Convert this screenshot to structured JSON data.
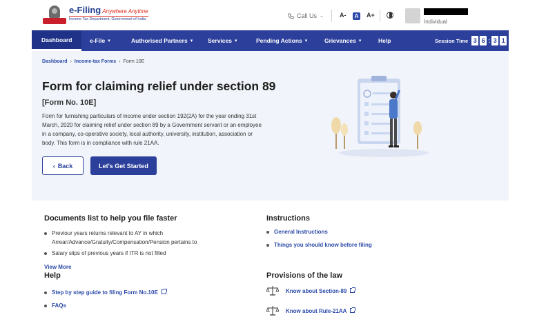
{
  "header": {
    "logo_title": "e-Filing",
    "logo_tagline": "Anywhere Anytime",
    "logo_subtitle": "Income Tax Department, Government of India",
    "call_us": "Call Us",
    "font_decrease": "A-",
    "font_normal": "A",
    "font_increase": "A+",
    "user_role": "Individual"
  },
  "nav": {
    "items": [
      {
        "label": "Dashboard"
      },
      {
        "label": "e-File"
      },
      {
        "label": "Authorised Partners"
      },
      {
        "label": "Services"
      },
      {
        "label": "Pending Actions"
      },
      {
        "label": "Grievances"
      },
      {
        "label": "Help"
      }
    ],
    "session_label": "Session Time",
    "session_digits": [
      "3",
      "6",
      "3",
      "1"
    ]
  },
  "breadcrumb": [
    "Dashboard",
    "Income-tax Forms",
    "Form 10E"
  ],
  "hero": {
    "title": "Form for claiming relief under section 89",
    "form_no": "[Form No. 10E]",
    "description": "Form for furnishing particulars of income under section 192(2A) for the year ending 31st March, 2020 for claiming relief under section 89 by a Government servant or an employee in a company, co-operative society, local authority, university, institution, association or body. This form is in compliance with rule 21AA.",
    "back_label": "Back",
    "start_label": "Let's Get Started"
  },
  "documents": {
    "title": "Documents list to help you file faster",
    "items": [
      "Previour years returns relevant to AY in which Arrear/Advance/Gratuity/Compensation/Pension pertains to",
      "Salary slips of previous years if ITR is not filled"
    ],
    "view_more": "View More"
  },
  "instructions": {
    "title": "Instructions",
    "items": [
      "General Instructions",
      "Things you should know before filing"
    ]
  },
  "help": {
    "title": "Help",
    "items": [
      "Step by step guide to filing Form No.10E",
      "FAQs"
    ]
  },
  "provisions": {
    "title": "Provisions of the law",
    "items": [
      "Know about Section-89",
      "Know about Rule-21AA"
    ]
  },
  "colors": {
    "primary": "#2b3f9b",
    "hero_bg": "#f1f4fa",
    "link": "#2b4aa8"
  }
}
